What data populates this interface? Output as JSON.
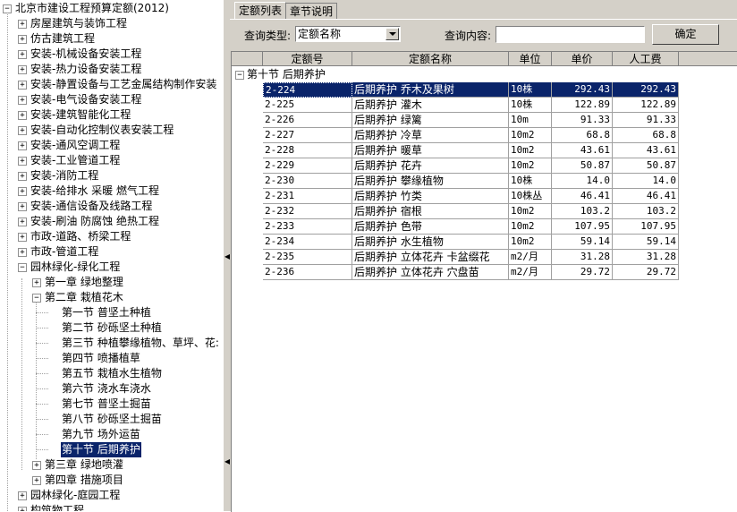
{
  "tree": {
    "root_label": "北京市建设工程预算定额(2012)",
    "items": [
      {
        "label": "房屋建筑与装饰工程",
        "level": 1,
        "expanded": false
      },
      {
        "label": "仿古建筑工程",
        "level": 1,
        "expanded": false
      },
      {
        "label": "安装-机械设备安装工程",
        "level": 1,
        "expanded": false
      },
      {
        "label": "安装-热力设备安装工程",
        "level": 1,
        "expanded": false
      },
      {
        "label": "安装-静置设备与工艺金属结构制作安装",
        "level": 1,
        "expanded": false
      },
      {
        "label": "安装-电气设备安装工程",
        "level": 1,
        "expanded": false
      },
      {
        "label": "安装-建筑智能化工程",
        "level": 1,
        "expanded": false
      },
      {
        "label": "安装-自动化控制仪表安装工程",
        "level": 1,
        "expanded": false
      },
      {
        "label": "安装-通风空调工程",
        "level": 1,
        "expanded": false
      },
      {
        "label": "安装-工业管道工程",
        "level": 1,
        "expanded": false
      },
      {
        "label": "安装-消防工程",
        "level": 1,
        "expanded": false
      },
      {
        "label": "安装-给排水 采暖 燃气工程",
        "level": 1,
        "expanded": false
      },
      {
        "label": "安装-通信设备及线路工程",
        "level": 1,
        "expanded": false
      },
      {
        "label": "安装-刷油 防腐蚀 绝热工程",
        "level": 1,
        "expanded": false
      },
      {
        "label": "市政-道路、桥梁工程",
        "level": 1,
        "expanded": false
      },
      {
        "label": "市政-管道工程",
        "level": 1,
        "expanded": false
      },
      {
        "label": "园林绿化-绿化工程",
        "level": 1,
        "expanded": true
      },
      {
        "label": "第一章 绿地整理",
        "level": 2,
        "expanded": false
      },
      {
        "label": "第二章 栽植花木",
        "level": 2,
        "expanded": true
      },
      {
        "label": "第一节 普坚土种植",
        "level": 3,
        "leaf": true
      },
      {
        "label": "第二节 砂砾坚土种植",
        "level": 3,
        "leaf": true
      },
      {
        "label": "第三节 种植攀缘植物、草坪、花:",
        "level": 3,
        "leaf": true
      },
      {
        "label": "第四节 喷播植草",
        "level": 3,
        "leaf": true
      },
      {
        "label": "第五节 栽植水生植物",
        "level": 3,
        "leaf": true
      },
      {
        "label": "第六节 浇水车浇水",
        "level": 3,
        "leaf": true
      },
      {
        "label": "第七节 普坚土掘苗",
        "level": 3,
        "leaf": true
      },
      {
        "label": "第八节 砂砾坚土掘苗",
        "level": 3,
        "leaf": true
      },
      {
        "label": "第九节 场外运苗",
        "level": 3,
        "leaf": true
      },
      {
        "label": "第十节 后期养护",
        "level": 3,
        "leaf": true,
        "selected": true
      },
      {
        "label": "第三章 绿地喷灌",
        "level": 2,
        "expanded": false
      },
      {
        "label": "第四章 措施项目",
        "level": 2,
        "expanded": false
      },
      {
        "label": "园林绿化-庭园工程",
        "level": 1,
        "expanded": false
      },
      {
        "label": "构筑物工程",
        "level": 1,
        "expanded": false
      }
    ]
  },
  "tabs": [
    {
      "label": "定额列表",
      "active": true
    },
    {
      "label": "章节说明",
      "active": false
    }
  ],
  "query": {
    "type_label": "查询类型:",
    "type_value": "定额名称",
    "content_label": "查询内容:",
    "content_value": "",
    "confirm_label": "确定"
  },
  "grid": {
    "columns": [
      "定额号",
      "定额名称",
      "单位",
      "单价",
      "人工费"
    ],
    "group_label": "第十节 后期养护",
    "rows": [
      {
        "code": "2-224",
        "name": "后期养护 乔木及果树",
        "unit": "10株",
        "price": "292.43",
        "labor": "292.43",
        "selected": true
      },
      {
        "code": "2-225",
        "name": "后期养护 灌木",
        "unit": "10株",
        "price": "122.89",
        "labor": "122.89"
      },
      {
        "code": "2-226",
        "name": "后期养护 绿篱",
        "unit": "10m",
        "price": "91.33",
        "labor": "91.33"
      },
      {
        "code": "2-227",
        "name": "后期养护 冷草",
        "unit": "10m2",
        "price": "68.8",
        "labor": "68.8"
      },
      {
        "code": "2-228",
        "name": "后期养护 暖草",
        "unit": "10m2",
        "price": "43.61",
        "labor": "43.61"
      },
      {
        "code": "2-229",
        "name": "后期养护 花卉",
        "unit": "10m2",
        "price": "50.87",
        "labor": "50.87"
      },
      {
        "code": "2-230",
        "name": "后期养护 攀缘植物",
        "unit": "10株",
        "price": "14.0",
        "labor": "14.0"
      },
      {
        "code": "2-231",
        "name": "后期养护 竹类",
        "unit": "10株丛",
        "price": "46.41",
        "labor": "46.41"
      },
      {
        "code": "2-232",
        "name": "后期养护 宿根",
        "unit": "10m2",
        "price": "103.2",
        "labor": "103.2"
      },
      {
        "code": "2-233",
        "name": "后期养护 色带",
        "unit": "10m2",
        "price": "107.95",
        "labor": "107.95"
      },
      {
        "code": "2-234",
        "name": "后期养护 水生植物",
        "unit": "10m2",
        "price": "59.14",
        "labor": "59.14"
      },
      {
        "code": "2-235",
        "name": "后期养护 立体花卉 卡盆缀花",
        "unit": "m2/月",
        "price": "31.28",
        "labor": "31.28"
      },
      {
        "code": "2-236",
        "name": "后期养护 立体花卉 穴盘苗",
        "unit": "m2/月",
        "price": "29.72",
        "labor": "29.72"
      }
    ]
  }
}
